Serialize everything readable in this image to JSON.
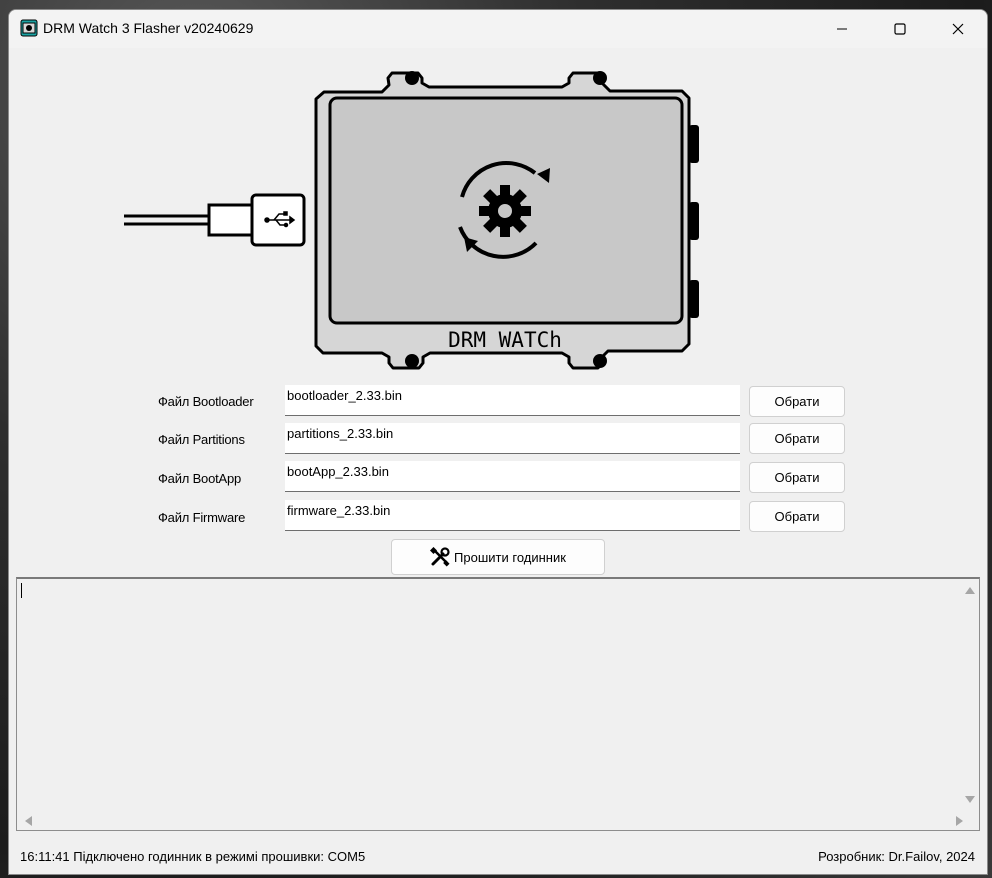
{
  "window": {
    "title": "DRM Watch 3 Flasher v20240629"
  },
  "device": {
    "label": "DRM WATCh"
  },
  "files": [
    {
      "label": "Файл Bootloader",
      "value": "bootloader_2.33.bin",
      "button": "Обрати"
    },
    {
      "label": "Файл Partitions",
      "value": "partitions_2.33.bin",
      "button": "Обрати"
    },
    {
      "label": "Файл BootApp",
      "value": "bootApp_2.33.bin",
      "button": "Обрати"
    },
    {
      "label": "Файл Firmware",
      "value": "firmware_2.33.bin",
      "button": "Обрати"
    }
  ],
  "actions": {
    "flash_label": "Прошити годинник"
  },
  "log": {
    "text": ""
  },
  "status": {
    "message": "16:11:41 Підключено годинник в режимі прошивки: COM5",
    "author": "Розробник: Dr.Failov, 2024"
  },
  "icons": {
    "app": "app-icon",
    "usb": "usb-icon",
    "gear_refresh": "gear-refresh-icon",
    "tools": "tools-icon"
  },
  "colors": {
    "window_bg": "#f0f0f0",
    "device_screen": "#c8c8c8",
    "device_outline": "#000000"
  }
}
